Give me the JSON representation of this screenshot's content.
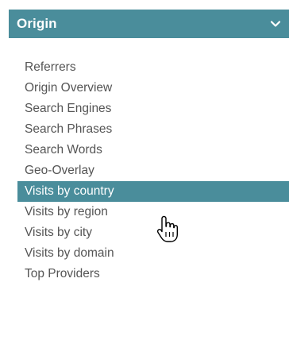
{
  "header": {
    "title": "Origin",
    "toggle_icon": "chevron-down-icon"
  },
  "menu": {
    "items": [
      {
        "label": "Referrers",
        "selected": false
      },
      {
        "label": "Origin Overview",
        "selected": false
      },
      {
        "label": "Search Engines",
        "selected": false
      },
      {
        "label": "Search Phrases",
        "selected": false
      },
      {
        "label": "Search Words",
        "selected": false
      },
      {
        "label": "Geo-Overlay",
        "selected": false
      },
      {
        "label": "Visits by country",
        "selected": true
      },
      {
        "label": "Visits by region",
        "selected": false
      },
      {
        "label": "Visits by city",
        "selected": false
      },
      {
        "label": "Visits by domain",
        "selected": false
      },
      {
        "label": "Top Providers",
        "selected": false
      }
    ]
  },
  "cursor": "hand-pointer-icon",
  "colors": {
    "accent": "#4a8d9b",
    "text": "#555555",
    "selected_text": "#ffffff"
  }
}
